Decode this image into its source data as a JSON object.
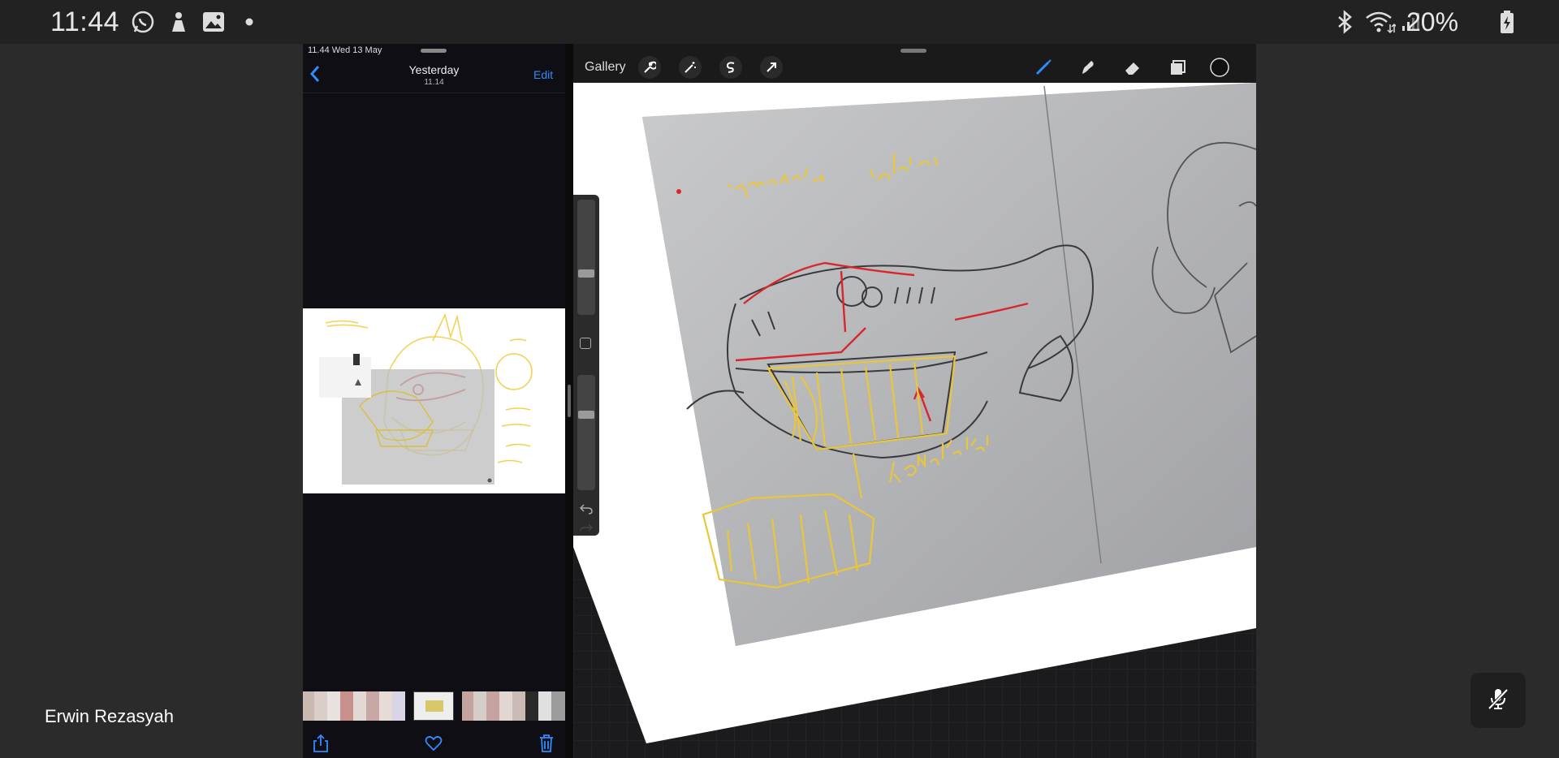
{
  "status_bar": {
    "time": "11:44",
    "battery_percent": "20%",
    "left_icons": [
      "whatsapp-icon",
      "app-notification-icon",
      "gallery-icon",
      "dot-icon"
    ],
    "right_icons": [
      "bluetooth-icon",
      "wifi-icon",
      "signal-icon",
      "battery-icon"
    ]
  },
  "photos_app": {
    "status": "11.44  Wed 13 May",
    "title": "Yesterday",
    "subtitle": "11.14",
    "edit_label": "Edit",
    "toolbar_icons": [
      "share-icon",
      "heart-icon",
      "trash-icon"
    ]
  },
  "procreate": {
    "gallery_label": "Gallery",
    "left_tools": [
      "wrench-icon",
      "magic-wand-icon",
      "selection-icon",
      "transform-icon"
    ],
    "right_tools": [
      "brush-icon",
      "smudge-icon",
      "eraser-icon",
      "layers-icon",
      "color-icon"
    ],
    "sketch_text": {
      "material": "• Material : fabrik.",
      "konstruksi": "Konstruksi"
    }
  },
  "meeting": {
    "participant_name": "Erwin Rezasyah"
  },
  "colors": {
    "ios_blue": "#2f8cff",
    "red_pencil": "#d8262a",
    "yellow_pencil": "#e9c63a"
  }
}
